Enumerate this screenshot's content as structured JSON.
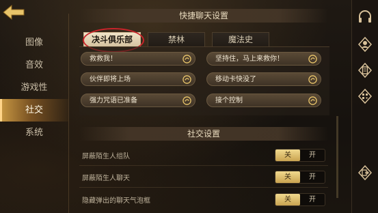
{
  "nav": {
    "items": [
      {
        "label": "图像",
        "active": false
      },
      {
        "label": "音效",
        "active": false
      },
      {
        "label": "游戏性",
        "active": false
      },
      {
        "label": "社交",
        "active": true
      },
      {
        "label": "系统",
        "active": false
      }
    ]
  },
  "quick_chat": {
    "header": "快捷聊天设置",
    "tabs": [
      {
        "label": "决斗俱乐部",
        "active": true
      },
      {
        "label": "禁林",
        "active": false
      },
      {
        "label": "魔法史",
        "active": false
      }
    ],
    "phrases": [
      "救救我！",
      "坚持住，马上来救你！",
      "伙伴即将上场",
      "移动卡快没了",
      "强力咒语已准备",
      "接个控制"
    ]
  },
  "social": {
    "header": "社交设置",
    "rows": [
      {
        "label": "屏蔽陌生人组队",
        "off_label": "关",
        "on_label": "开",
        "selected": "关"
      },
      {
        "label": "屏蔽陌生人聊天",
        "off_label": "关",
        "on_label": "开",
        "selected": "关"
      },
      {
        "label": "隐藏弹出的聊天气泡框",
        "off_label": "关",
        "on_label": "开",
        "selected": "关"
      }
    ]
  },
  "colors": {
    "accent": "#d4a04a",
    "highlight_circle": "#c8242a"
  },
  "icons": [
    "back-arrow-icon",
    "headset-icon",
    "avatar-pin-icon",
    "notebook-icon",
    "qr-code-icon",
    "exit-icon",
    "edit-swirl-icon"
  ]
}
